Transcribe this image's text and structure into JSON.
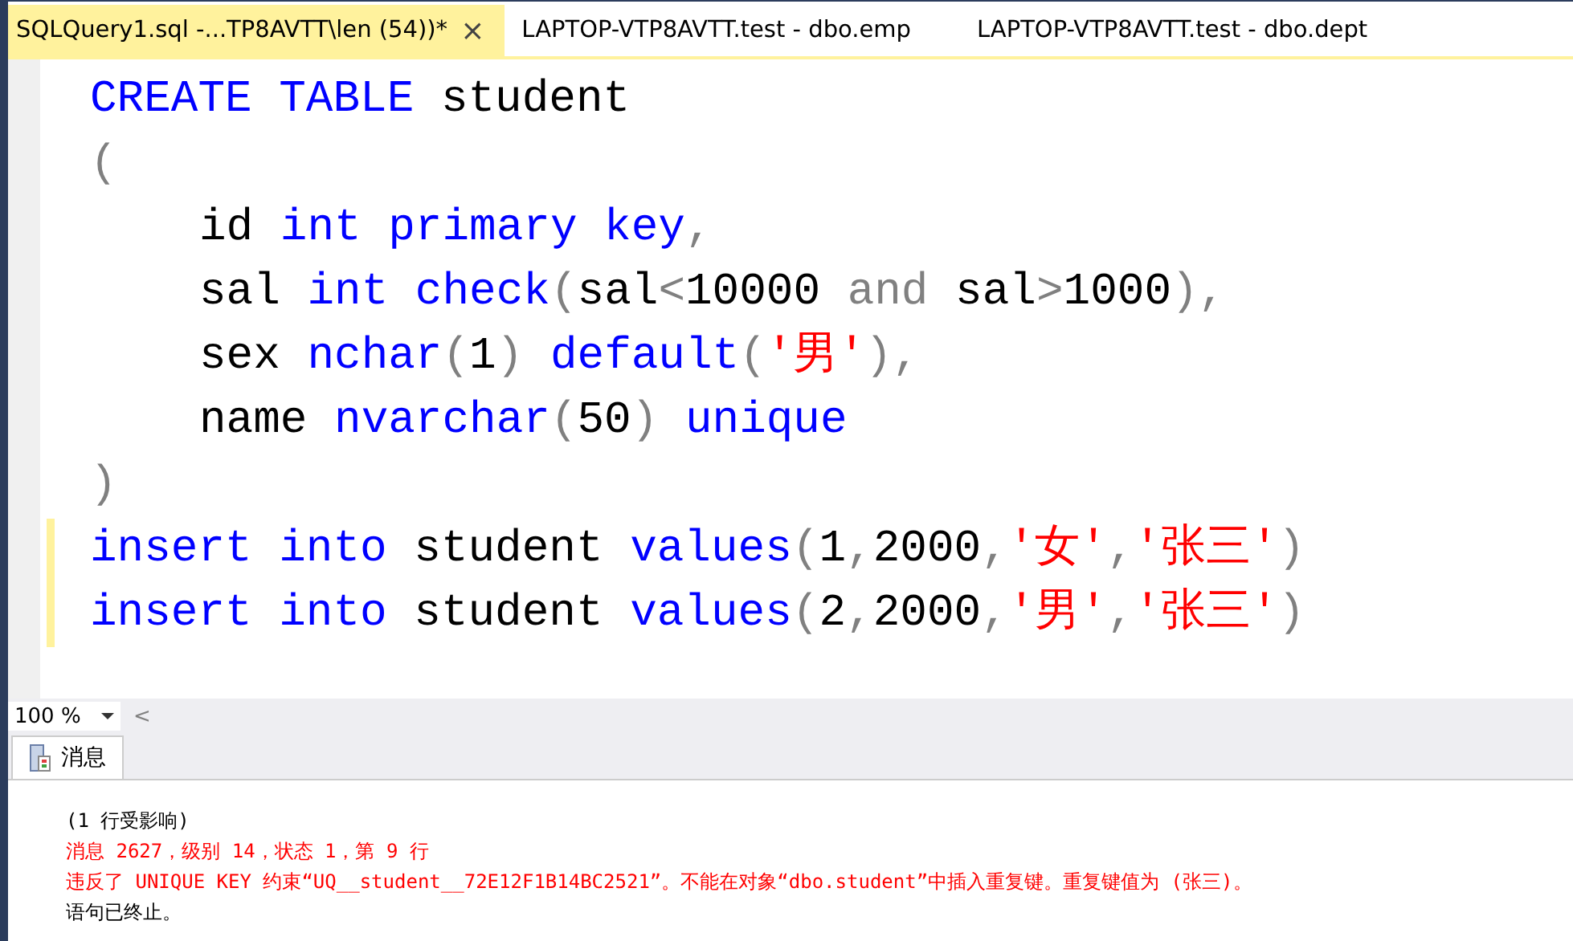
{
  "tabs": [
    {
      "label": "SQLQuery1.sql -...TP8AVTT\\len (54))*",
      "selected": true,
      "close": "×"
    },
    {
      "label": "LAPTOP-VTP8AVTT.test - dbo.emp",
      "selected": false
    },
    {
      "label": "LAPTOP-VTP8AVTT.test - dbo.dept",
      "selected": false
    }
  ],
  "editor": {
    "lines": [
      {
        "indented": false,
        "modified": false,
        "tokens": [
          {
            "text": "CREATE TABLE",
            "kind": "keyword"
          },
          {
            "text": " student",
            "kind": "plain"
          }
        ]
      },
      {
        "indented": false,
        "modified": false,
        "tokens": [
          {
            "text": "(",
            "kind": "operator"
          }
        ]
      },
      {
        "indented": true,
        "modified": false,
        "tokens": [
          {
            "text": "id ",
            "kind": "plain"
          },
          {
            "text": "int primary key",
            "kind": "keyword"
          },
          {
            "text": ",",
            "kind": "operator"
          }
        ]
      },
      {
        "indented": true,
        "modified": false,
        "tokens": [
          {
            "text": "sal ",
            "kind": "plain"
          },
          {
            "text": "int check",
            "kind": "keyword"
          },
          {
            "text": "(",
            "kind": "operator"
          },
          {
            "text": "sal",
            "kind": "plain"
          },
          {
            "text": "<",
            "kind": "operator"
          },
          {
            "text": "10000 ",
            "kind": "plain"
          },
          {
            "text": "and",
            "kind": "operator"
          },
          {
            "text": " sal",
            "kind": "plain"
          },
          {
            "text": ">",
            "kind": "operator"
          },
          {
            "text": "1000",
            "kind": "plain"
          },
          {
            "text": "),",
            "kind": "operator"
          }
        ]
      },
      {
        "indented": true,
        "modified": false,
        "tokens": [
          {
            "text": "sex ",
            "kind": "plain"
          },
          {
            "text": "nchar",
            "kind": "keyword"
          },
          {
            "text": "(",
            "kind": "operator"
          },
          {
            "text": "1",
            "kind": "plain"
          },
          {
            "text": ") ",
            "kind": "operator"
          },
          {
            "text": "default",
            "kind": "keyword"
          },
          {
            "text": "(",
            "kind": "operator"
          },
          {
            "text": "'男'",
            "kind": "string"
          },
          {
            "text": "),",
            "kind": "operator"
          }
        ]
      },
      {
        "indented": true,
        "modified": false,
        "tokens": [
          {
            "text": "name ",
            "kind": "plain"
          },
          {
            "text": "nvarchar",
            "kind": "keyword"
          },
          {
            "text": "(",
            "kind": "operator"
          },
          {
            "text": "50",
            "kind": "plain"
          },
          {
            "text": ") ",
            "kind": "operator"
          },
          {
            "text": "unique",
            "kind": "keyword"
          }
        ]
      },
      {
        "indented": false,
        "modified": false,
        "tokens": [
          {
            "text": ")",
            "kind": "operator"
          }
        ]
      },
      {
        "indented": false,
        "modified": true,
        "tokens": [
          {
            "text": "insert into",
            "kind": "keyword"
          },
          {
            "text": " student ",
            "kind": "plain"
          },
          {
            "text": "values",
            "kind": "keyword"
          },
          {
            "text": "(",
            "kind": "operator"
          },
          {
            "text": "1",
            "kind": "plain"
          },
          {
            "text": ",",
            "kind": "operator"
          },
          {
            "text": "2000",
            "kind": "plain"
          },
          {
            "text": ",",
            "kind": "operator"
          },
          {
            "text": "'女'",
            "kind": "string"
          },
          {
            "text": ",",
            "kind": "operator"
          },
          {
            "text": "'张三'",
            "kind": "string"
          },
          {
            "text": ")",
            "kind": "operator"
          }
        ]
      },
      {
        "indented": false,
        "modified": true,
        "tokens": [
          {
            "text": "insert into",
            "kind": "keyword"
          },
          {
            "text": " student ",
            "kind": "plain"
          },
          {
            "text": "values",
            "kind": "keyword"
          },
          {
            "text": "(",
            "kind": "operator"
          },
          {
            "text": "2",
            "kind": "plain"
          },
          {
            "text": ",",
            "kind": "operator"
          },
          {
            "text": "2000",
            "kind": "plain"
          },
          {
            "text": ",",
            "kind": "operator"
          },
          {
            "text": "'男'",
            "kind": "string"
          },
          {
            "text": ",",
            "kind": "operator"
          },
          {
            "text": "'张三'",
            "kind": "string"
          },
          {
            "text": ")",
            "kind": "operator"
          }
        ]
      }
    ]
  },
  "zoom": {
    "value": "100 %",
    "scroll_left": "<"
  },
  "results_tabs": [
    {
      "label": "消息",
      "selected": true
    }
  ],
  "messages": [
    {
      "kind": "info",
      "text": "(1 行受影响)"
    },
    {
      "kind": "error",
      "text": "消息 2627，级别 14，状态 1，第 9 行"
    },
    {
      "kind": "error",
      "text": "违反了 UNIQUE KEY 约束“UQ__student__72E12F1B14BC2521”。不能在对象“dbo.student”中插入重复键。重复键值为 (张三)。"
    },
    {
      "kind": "info",
      "text": "语句已终止。"
    }
  ]
}
